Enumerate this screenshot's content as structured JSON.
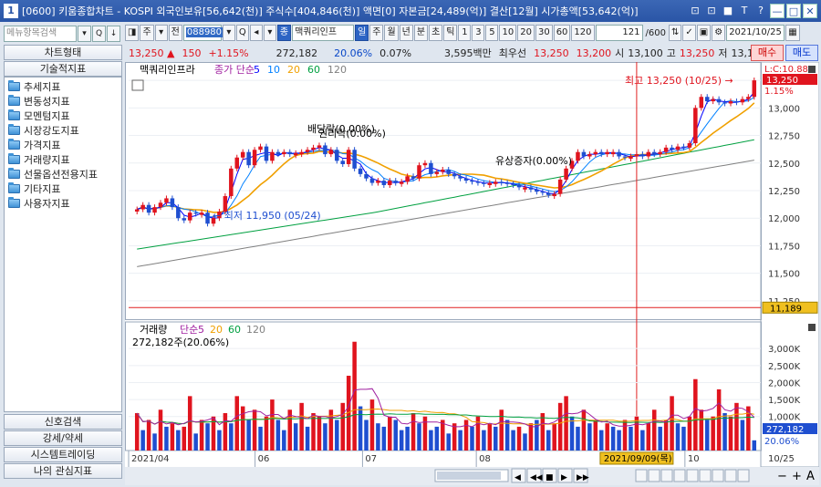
{
  "window": {
    "number": "1",
    "title": "[0600] 키움종합차트 - KOSPI 외국인보유[56,642(천)] 주식수[404,846(천)] 액면[0] 자본금[24,489(억)] 결산[12월] 시가총액[53,642(억)]",
    "buttons": [
      "⊡",
      "⊡",
      "■",
      "T",
      "?",
      "—",
      "□",
      "✕"
    ]
  },
  "left_panel": {
    "search_placeholder": "메뉴항목검색",
    "search_buttons": [
      "▾",
      "Q",
      "↓"
    ],
    "tab_chart_type": "차트형태",
    "tab_technical": "기술적지표",
    "tree_items": [
      "추세지표",
      "변동성지표",
      "모멘텀지표",
      "시장강도지표",
      "가격지표",
      "거래량지표",
      "선물옵션전용지표",
      "기타지표",
      "사용자지표"
    ],
    "bottom_tabs": [
      "신호검색",
      "강세/약세",
      "시스템트레이딩",
      "나의 관심지표"
    ]
  },
  "toolbar": {
    "buttons_left": [
      "◨",
      "주",
      "▾",
      "전"
    ],
    "code": "088980",
    "code_buttons": [
      "▾",
      "Q"
    ],
    "stock_name": "맥쿼리인프",
    "period_buttons": [
      "일",
      "주",
      "월",
      "년",
      "분",
      "초",
      "틱"
    ],
    "active_period": "일",
    "intervals": [
      "1",
      "3",
      "5",
      "10",
      "20",
      "30",
      "60",
      "120"
    ],
    "count": "121",
    "count_total": "/600",
    "date": "2021/10/25"
  },
  "quote": {
    "price": "13,250",
    "arrow": "▲",
    "change": "150",
    "change_pct": "+1.15%",
    "volume": "272,182",
    "vol_ratio": "20.06%",
    "turnover": "0.07%",
    "amount": "3,595백만",
    "best": "최우선",
    "ask": "13,250",
    "bid": "13,200",
    "open_label": "시",
    "open": "13,100",
    "high_label": "고",
    "high": "13,250",
    "low_label": "저",
    "low": "13,100",
    "buy_label": "매수",
    "sell_label": "매도"
  },
  "chart_data": [
    {
      "type": "candlestick",
      "title": "맥쿼리인프라",
      "ma_legend": [
        "종가",
        "단순",
        "5",
        "10",
        "20",
        "60",
        "120"
      ],
      "ma_colors": {
        "5": "#0000ff",
        "10": "#0080ff",
        "20": "#f0a000",
        "60": "#00a040",
        "120": "#808080"
      },
      "y_ticks": [
        11250,
        11500,
        11750,
        12000,
        12250,
        12500,
        12750,
        13000,
        13250
      ],
      "ylim": [
        11150,
        13350
      ],
      "x_labels": [
        "2021/04",
        "06",
        "07",
        "08",
        "10"
      ],
      "annotations": {
        "high": "최고 13,250 (10/25)",
        "low": "최저 11,950 (05/24)",
        "div1": "배당락(0.00%)",
        "div2": "권리락(0.00%)",
        "rights": "유상증자(0.00%)"
      },
      "right_labels": {
        "top": "L:C:10.88",
        "price": "13,250",
        "pct": "1.15%",
        "cross": "11,189"
      },
      "candles": [
        12080,
        12120,
        12050,
        12100,
        12140,
        12180,
        12100,
        12000,
        11980,
        12050,
        12040,
        12050,
        11950,
        12000,
        12060,
        12200,
        12450,
        12550,
        12600,
        12480,
        12620,
        12650,
        12520,
        12600,
        12580,
        12600,
        12580,
        12590,
        12600,
        12620,
        12640,
        12660,
        12580,
        12620,
        12520,
        12490,
        12620,
        12450,
        12400,
        12360,
        12320,
        12340,
        12300,
        12340,
        12320,
        12330,
        12380,
        12360,
        12480,
        12500,
        12400,
        12420,
        12440,
        12400,
        12380,
        12360,
        12340,
        12330,
        12320,
        12310,
        12320,
        12330,
        12320,
        12310,
        12300,
        12280,
        12280,
        12260,
        12240,
        12230,
        12210,
        12220,
        12350,
        12450,
        12520,
        12600,
        12560,
        12580,
        12600,
        12580,
        12600,
        12600,
        12560,
        12550,
        12560,
        12580,
        12560,
        12600,
        12580,
        12600,
        12640,
        12620,
        12650,
        12640,
        12680,
        13000,
        13100,
        13060,
        13080,
        13050,
        13040,
        13060,
        13050,
        13080,
        13100,
        13250
      ]
    },
    {
      "type": "bar",
      "title": "거래량",
      "ma_legend": [
        "단순",
        "5",
        "20",
        "60",
        "120"
      ],
      "volume_label": "272,182주(20.06%)",
      "y_ticks": [
        "1,000K",
        "1,500K",
        "2,000K",
        "2,500K",
        "3,000K"
      ],
      "ylim": [
        0,
        3300
      ],
      "right_labels": {
        "vol": "272,182",
        "pct": "20.06%"
      },
      "cursor_date": "2021/09/09(목)",
      "values": [
        1100,
        600,
        900,
        500,
        1200,
        700,
        800,
        600,
        700,
        1600,
        500,
        900,
        800,
        1000,
        600,
        1100,
        800,
        1600,
        1300,
        900,
        1200,
        700,
        1000,
        1500,
        900,
        600,
        1200,
        800,
        1400,
        700,
        1100,
        1000,
        800,
        1200,
        900,
        1400,
        2200,
        3200,
        1300,
        900,
        1500,
        800,
        700,
        1000,
        900,
        600,
        700,
        1100,
        800,
        1000,
        600,
        700,
        900,
        500,
        800,
        600,
        900,
        700,
        1000,
        600,
        800,
        700,
        1200,
        900,
        600,
        700,
        500,
        800,
        900,
        1100,
        600,
        800,
        1400,
        1600,
        1000,
        700,
        1200,
        800,
        900,
        600,
        800,
        700,
        600,
        900,
        700,
        1000,
        600,
        800,
        1200,
        700,
        900,
        1600,
        800,
        700,
        1000,
        2100,
        1200,
        900,
        1000,
        1800,
        1100,
        1000,
        1400,
        900,
        1300,
        300
      ],
      "up_flags": [
        1,
        0,
        1,
        0,
        1,
        0,
        1,
        0,
        1,
        1,
        0,
        1,
        0,
        1,
        0,
        1,
        0,
        1,
        1,
        0,
        1,
        0,
        1,
        1,
        0,
        0,
        1,
        0,
        1,
        0,
        1,
        1,
        0,
        1,
        0,
        1,
        1,
        1,
        0,
        0,
        1,
        0,
        0,
        1,
        0,
        0,
        0,
        1,
        0,
        1,
        0,
        0,
        1,
        0,
        1,
        0,
        1,
        0,
        1,
        0,
        1,
        0,
        1,
        0,
        0,
        1,
        0,
        1,
        0,
        1,
        0,
        1,
        1,
        1,
        0,
        0,
        1,
        0,
        1,
        0,
        1,
        0,
        0,
        1,
        0,
        1,
        0,
        1,
        1,
        0,
        1,
        1,
        0,
        0,
        1,
        1,
        1,
        0,
        1,
        1,
        0,
        1,
        1,
        0,
        1,
        0
      ]
    }
  ],
  "bottom_bar": {
    "date_end": "10/25",
    "nav_buttons": [
      "◀",
      "◀◀",
      "■",
      "▶",
      "▶▶"
    ],
    "zoom": [
      "−",
      "+",
      "A"
    ]
  }
}
